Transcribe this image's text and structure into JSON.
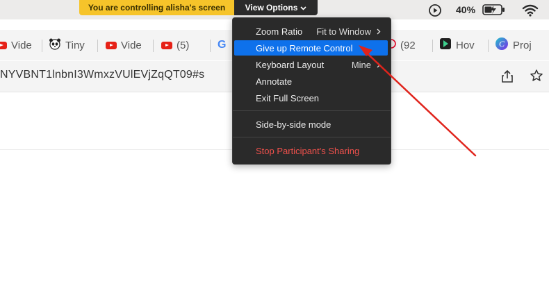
{
  "zoom_bar": {
    "banner_text": "You are controlling alisha's screen",
    "view_options_label": "View Options",
    "view_options_chevron": "chevron-down-icon"
  },
  "status_bar": {
    "battery_percent": "40%"
  },
  "tabs": [
    {
      "icon": "youtube-icon",
      "label": "Vide"
    },
    {
      "icon": "panda-icon",
      "label": "Tiny"
    },
    {
      "icon": "youtube-icon",
      "label": "Vide"
    },
    {
      "icon": "youtube-icon",
      "label": "(5)"
    },
    {
      "icon": "google-icon",
      "label": "G"
    },
    {
      "icon": "pinterest-icon",
      "label": "(92"
    },
    {
      "icon": "play-icon",
      "label": "Hov"
    },
    {
      "icon": "canva-icon",
      "label": "Proj"
    }
  ],
  "address_bar": {
    "url": "NYVBNT1lnbnI3WmxzVUlEVjZqQT09#s"
  },
  "menu": {
    "items": [
      {
        "label": "Zoom Ratio",
        "right": "Fit to Window"
      },
      {
        "label": "Give up Remote Control"
      },
      {
        "label": "Keyboard Layout",
        "right": "Mine"
      },
      {
        "label": "Annotate"
      },
      {
        "label": "Exit Full Screen"
      },
      {
        "label": "Side-by-side mode"
      },
      {
        "label": "Stop Participant's Sharing"
      }
    ],
    "highlight_color": "#0e71eb",
    "danger_color": "#f0514c"
  },
  "annotation": {
    "arrow_color": "#e0241c"
  }
}
